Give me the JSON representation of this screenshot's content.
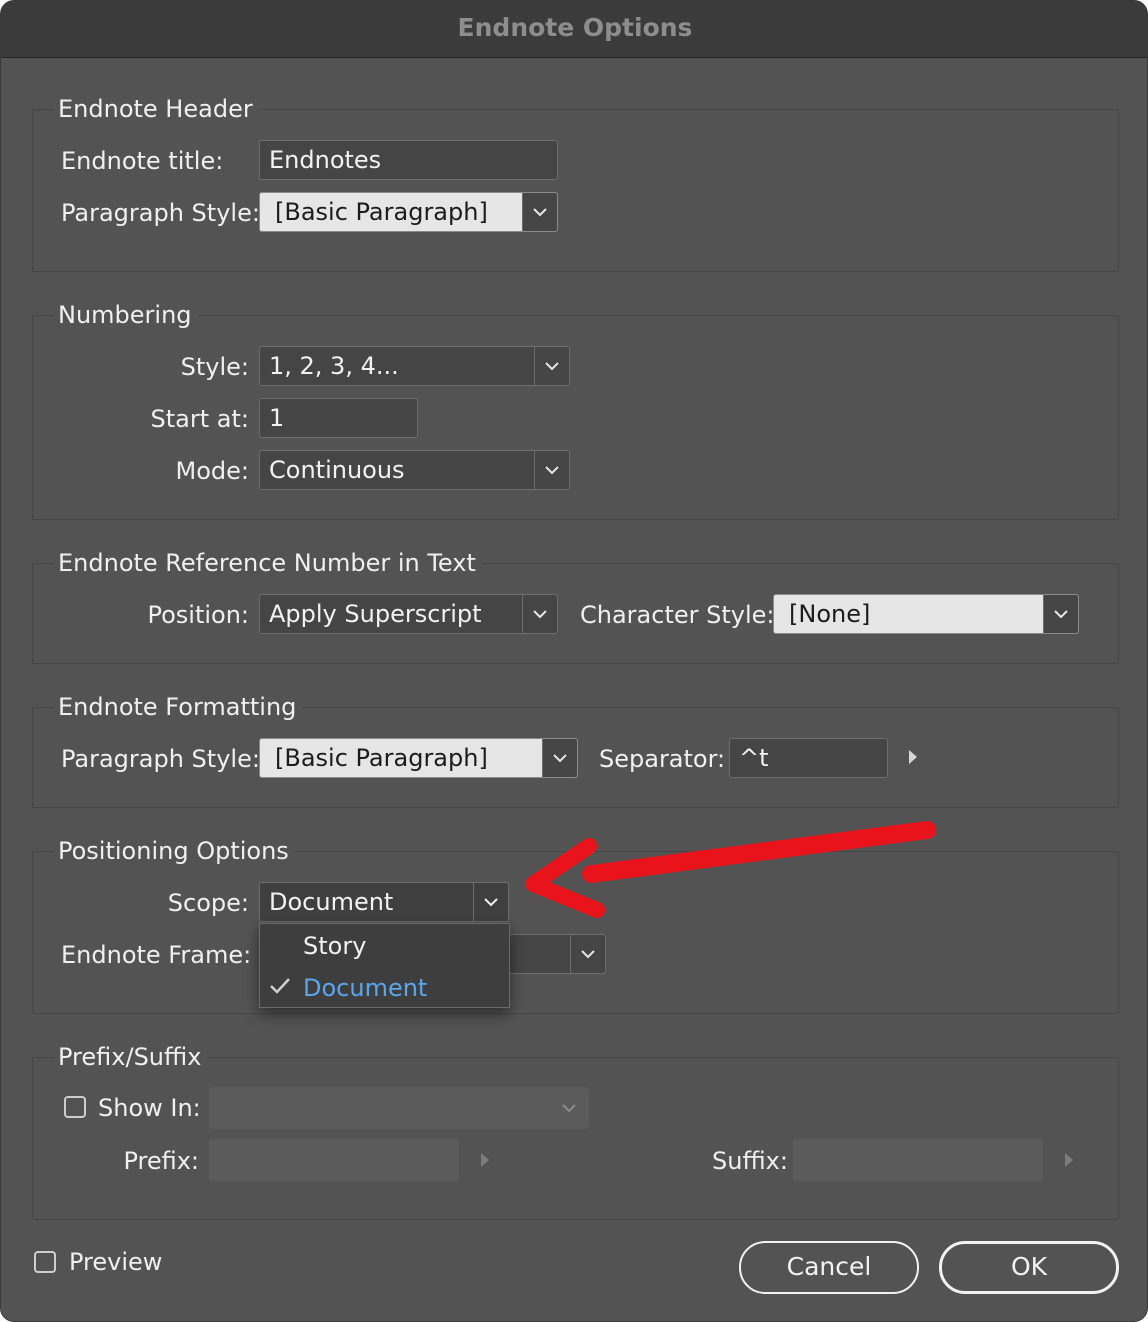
{
  "window": {
    "title": "Endnote Options"
  },
  "header_group": {
    "legend": "Endnote Header",
    "title_label": "Endnote title:",
    "title_value": "Endnotes",
    "para_style_label": "Paragraph Style:",
    "para_style_value": "[Basic Paragraph]"
  },
  "numbering": {
    "legend": "Numbering",
    "style_label": "Style:",
    "style_value": "1, 2, 3, 4...",
    "start_label": "Start at:",
    "start_value": "1",
    "mode_label": "Mode:",
    "mode_value": "Continuous"
  },
  "reference": {
    "legend": "Endnote Reference Number in Text",
    "position_label": "Position:",
    "position_value": "Apply Superscript",
    "char_style_label": "Character Style:",
    "char_style_value": "[None]"
  },
  "formatting": {
    "legend": "Endnote Formatting",
    "para_style_label": "Paragraph Style:",
    "para_style_value": "[Basic Paragraph]",
    "separator_label": "Separator:",
    "separator_value": "^t"
  },
  "positioning": {
    "legend": "Positioning Options",
    "scope_label": "Scope:",
    "scope_value": "Document",
    "frame_label": "Endnote Frame:",
    "scope_menu": [
      {
        "label": "Story",
        "checked": false
      },
      {
        "label": "Document",
        "checked": true
      }
    ]
  },
  "prefix_suffix": {
    "legend": "Prefix/Suffix",
    "show_in_label": "Show In:",
    "show_in_checked": false,
    "prefix_label": "Prefix:",
    "suffix_label": "Suffix:"
  },
  "footer": {
    "preview_label": "Preview",
    "preview_checked": false,
    "cancel_label": "Cancel",
    "ok_label": "OK"
  },
  "colors": {
    "dialog_bg": "#535353",
    "titlebar_bg": "#3b3b3b",
    "selected_menu_text": "#5aa6ec",
    "annotation_arrow": "#e8131b"
  }
}
